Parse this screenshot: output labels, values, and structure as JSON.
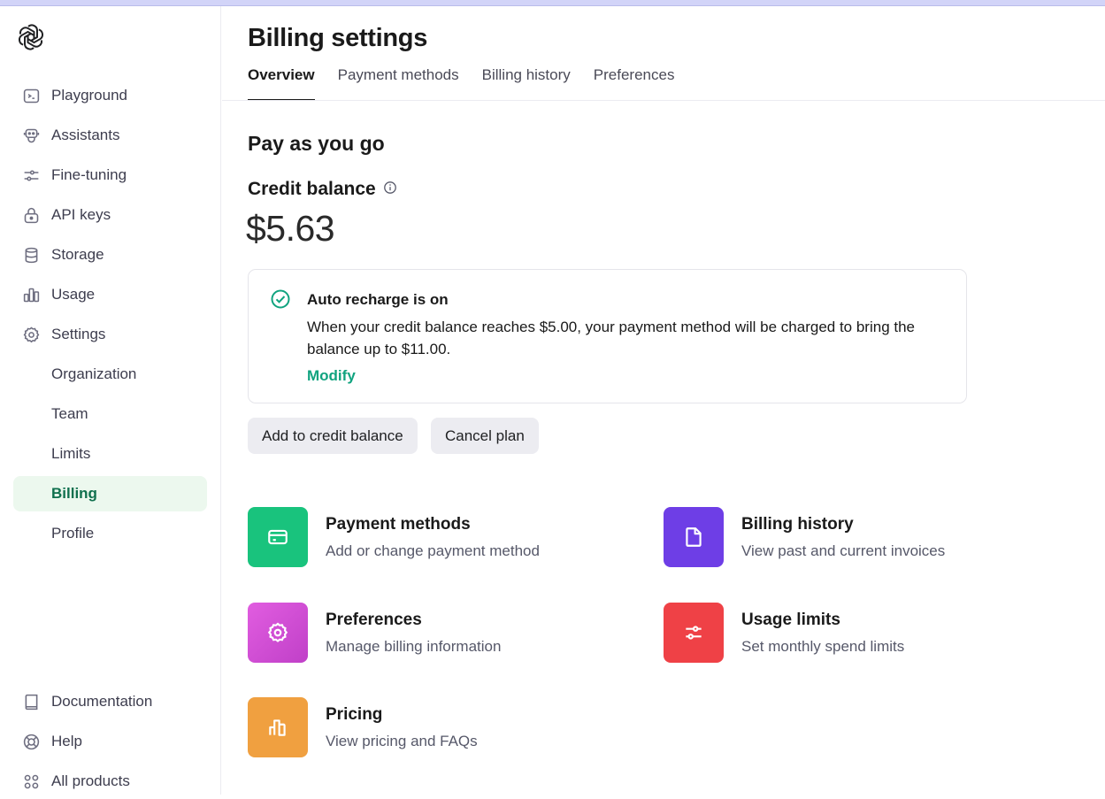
{
  "sidebar": {
    "logo_icon": "openai-logo",
    "items": [
      {
        "label": "Playground",
        "icon": "terminal-icon"
      },
      {
        "label": "Assistants",
        "icon": "robot-icon"
      },
      {
        "label": "Fine-tuning",
        "icon": "sliders-icon"
      },
      {
        "label": "API keys",
        "icon": "lock-icon"
      },
      {
        "label": "Storage",
        "icon": "database-icon"
      },
      {
        "label": "Usage",
        "icon": "bar-chart-icon"
      },
      {
        "label": "Settings",
        "icon": "gear-icon"
      }
    ],
    "sub_items": [
      {
        "label": "Organization"
      },
      {
        "label": "Team"
      },
      {
        "label": "Limits"
      },
      {
        "label": "Billing",
        "active": true
      },
      {
        "label": "Profile"
      }
    ],
    "footer_items": [
      {
        "label": "Documentation",
        "icon": "book-icon"
      },
      {
        "label": "Help",
        "icon": "lifebuoy-icon"
      },
      {
        "label": "All products",
        "icon": "grid-icon"
      }
    ]
  },
  "header": {
    "title": "Billing settings",
    "tabs": [
      {
        "label": "Overview",
        "active": true
      },
      {
        "label": "Payment methods"
      },
      {
        "label": "Billing history"
      },
      {
        "label": "Preferences"
      }
    ]
  },
  "main": {
    "section_title": "Pay as you go",
    "credit_label": "Credit balance",
    "credit_value": "$5.63",
    "recharge": {
      "title": "Auto recharge is on",
      "body": "When your credit balance reaches $5.00, your payment method will be charged to bring the balance up to $11.00.",
      "link": "Modify"
    },
    "buttons": {
      "add_credit": "Add to credit balance",
      "cancel_plan": "Cancel plan"
    },
    "tiles": [
      {
        "title": "Payment methods",
        "desc": "Add or change payment method",
        "icon": "credit-card-icon",
        "color": "#19c37d"
      },
      {
        "title": "Billing history",
        "desc": "View past and current invoices",
        "icon": "document-icon",
        "color": "#6e3ee6"
      },
      {
        "title": "Preferences",
        "desc": "Manage billing information",
        "icon": "gear-icon",
        "color": "#dc4fd0"
      },
      {
        "title": "Usage limits",
        "desc": "Set monthly spend limits",
        "icon": "sliders-icon",
        "color": "#ef4146"
      },
      {
        "title": "Pricing",
        "desc": "View pricing and FAQs",
        "icon": "bar-chart-icon",
        "color": "#f0a040"
      }
    ]
  },
  "colors": {
    "accent": "#10a37f",
    "active_nav_bg": "#ecf8ee",
    "active_nav_text": "#10704e"
  }
}
